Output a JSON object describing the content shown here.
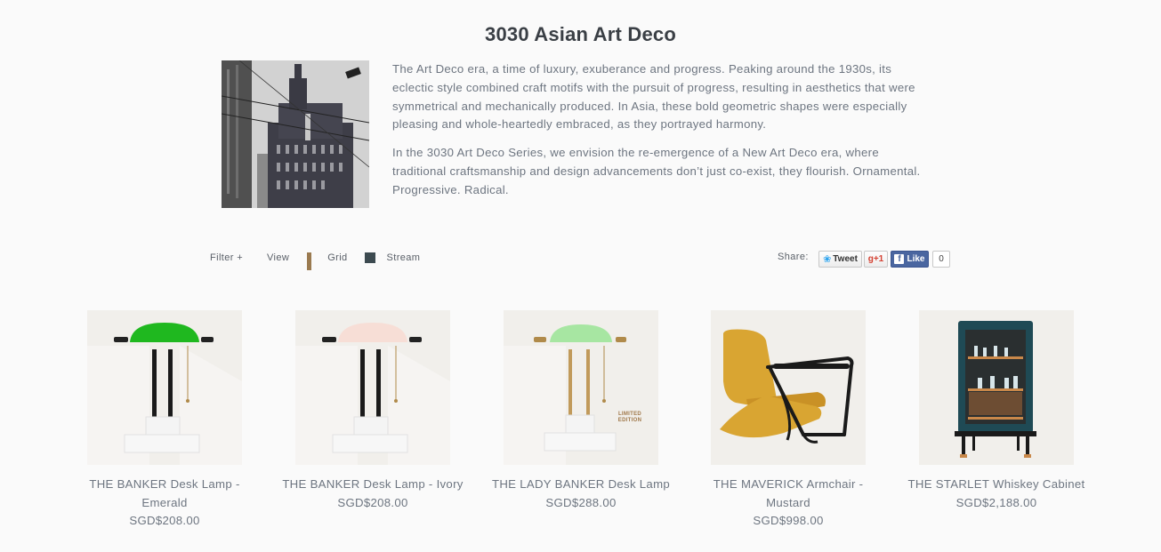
{
  "collection": {
    "title": "3030 Asian Art Deco",
    "paragraphs": [
      "The Art Deco era, a time of luxury, exuberance and progress. Peaking around the 1930s, its eclectic style combined craft motifs with the pursuit of progress, resulting in aesthetics that were symmetrical and mechanically produced. In Asia, these bold geometric shapes were especially pleasing and whole-heartedly embraced, as they portrayed harmony.",
      "In the 3030 Art Deco Series, we envision the re-emergence of a New Art Deco era, where traditional craftsmanship and design advancements don’t just co-exist, they flourish. Ornamental. Progressive. Radical."
    ]
  },
  "toolbar": {
    "filter_label": "Filter +",
    "view_label": "View",
    "grid_label": "Grid",
    "stream_label": "Stream",
    "grid_icon_color": "#9a7a50",
    "stream_icon_color": "#3c4a50"
  },
  "share": {
    "label": "Share:",
    "tweet_label": "Tweet",
    "gplus_label": "g+1",
    "like_label": "Like",
    "like_count": "0"
  },
  "products": [
    {
      "name": "THE BANKER Desk Lamp - Emerald",
      "price": "SGD$208.00",
      "shade_color": "#1fb81f"
    },
    {
      "name": "THE BANKER Desk Lamp - Ivory",
      "price": "SGD$208.00",
      "shade_color": "#f7ded6"
    },
    {
      "name": "THE LADY BANKER Desk Lamp",
      "price": "SGD$288.00",
      "shade_color": "#a7e6a2",
      "badge_line1": "LIMITED",
      "badge_line2": "EDITION"
    },
    {
      "name": "THE MAVERICK Armchair - Mustard",
      "price": "SGD$998.00",
      "seat_color": "#d9a532"
    },
    {
      "name": "THE STARLET Whiskey Cabinet",
      "price": "SGD$2,188.00",
      "body_color": "#1f4a55"
    }
  ]
}
